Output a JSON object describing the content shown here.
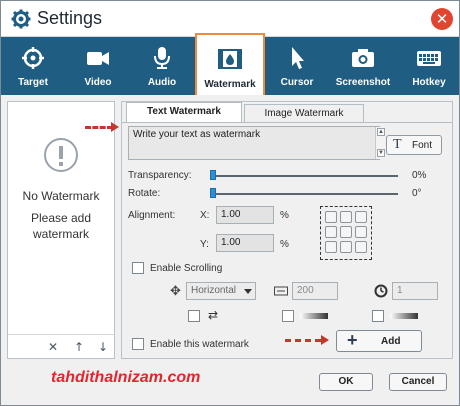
{
  "window": {
    "title": "Settings"
  },
  "toolbar": {
    "items": [
      {
        "label": "Target",
        "icon": "target-icon"
      },
      {
        "label": "Video",
        "icon": "video-camera-icon"
      },
      {
        "label": "Audio",
        "icon": "microphone-icon"
      },
      {
        "label": "Watermark",
        "icon": "watermark-icon",
        "active": true
      },
      {
        "label": "Cursor",
        "icon": "cursor-icon"
      },
      {
        "label": "Screenshot",
        "icon": "camera-icon"
      },
      {
        "label": "Hotkey",
        "icon": "keyboard-icon"
      }
    ]
  },
  "list": {
    "empty_title": "No Watermark",
    "empty_sub": "Please add watermark"
  },
  "tabs": {
    "text": "Text Watermark",
    "image": "Image Watermark"
  },
  "text_input": {
    "value": "Write your text as watermark"
  },
  "font_button": {
    "label": "Font"
  },
  "transparency": {
    "label": "Transparency:",
    "value": "0%"
  },
  "rotate": {
    "label": "Rotate:",
    "value": "0°"
  },
  "alignment": {
    "label": "Alignment:",
    "x_label": "X:",
    "x_value": "1.00",
    "x_unit": "%",
    "y_label": "Y:",
    "y_value": "1.00",
    "y_unit": "%"
  },
  "scrolling": {
    "label": "Enable Scrolling",
    "direction": "Horizontal",
    "speed": "200",
    "interval": "1"
  },
  "enable_watermark": {
    "label": "Enable this watermark"
  },
  "add_button": {
    "label": "Add"
  },
  "buttons": {
    "ok": "OK",
    "cancel": "Cancel"
  },
  "brand": {
    "text": "tahdithalnizam.com"
  },
  "colors": {
    "toolbar": "#1f5d82",
    "accent": "#f08a3c",
    "close": "#e0452f",
    "brand": "#e3262e"
  }
}
